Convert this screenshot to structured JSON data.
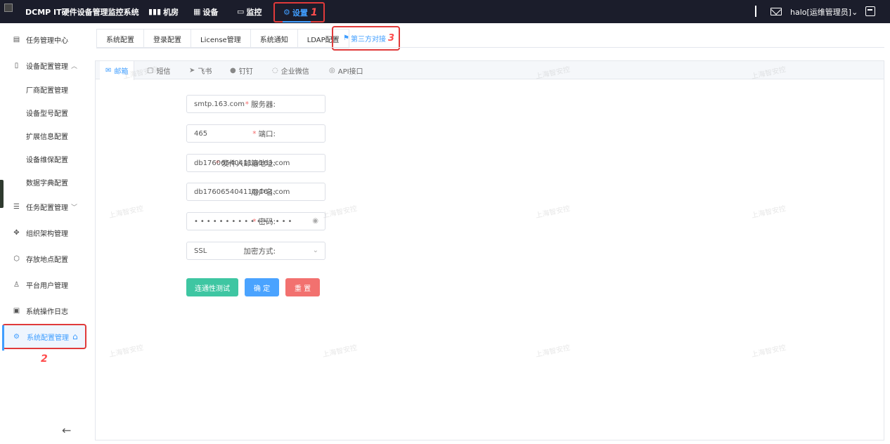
{
  "header": {
    "system_title": "DCMP IT硬件设备管理监控系统",
    "nav": [
      {
        "label": "机房",
        "icon": "bar-chart-icon"
      },
      {
        "label": "设备",
        "icon": "grid-icon"
      },
      {
        "label": "监控",
        "icon": "monitor-icon"
      },
      {
        "label": "设置",
        "icon": "gear-icon",
        "active": true,
        "annotation": "1"
      }
    ],
    "user": "halo[运维管理员]"
  },
  "sidebar": {
    "items": [
      {
        "label": "任务管理中心",
        "icon": "list-icon"
      },
      {
        "label": "设备配置管理",
        "icon": "device-icon",
        "chevron": "^"
      },
      {
        "label": "厂商配置管理",
        "sub": true
      },
      {
        "label": "设备型号配置",
        "sub": true
      },
      {
        "label": "扩展信息配置",
        "sub": true
      },
      {
        "label": "设备维保配置",
        "sub": true
      },
      {
        "label": "数据字典配置",
        "sub": true
      },
      {
        "label": "任务配置管理",
        "icon": "sliders-icon",
        "chevron": "v"
      },
      {
        "label": "组织架构管理",
        "icon": "org-icon"
      },
      {
        "label": "存放地点配置",
        "icon": "cube-icon"
      },
      {
        "label": "平台用户管理",
        "icon": "user-icon"
      },
      {
        "label": "系统操作日志",
        "icon": "log-icon"
      },
      {
        "label": "系统配置管理",
        "icon": "settings-icon",
        "active": true
      }
    ],
    "annotation": "2"
  },
  "tabs": {
    "items": [
      "系统配置",
      "登录配置",
      "License管理",
      "系统通知",
      "LDAP配置"
    ],
    "active": "第三方对接",
    "annotation": "3"
  },
  "subtabs": [
    {
      "label": "邮箱",
      "icon": "mail-icon",
      "active": true
    },
    {
      "label": "短信",
      "icon": "sms-icon"
    },
    {
      "label": "飞书",
      "icon": "send-icon"
    },
    {
      "label": "钉钉",
      "icon": "dingtalk-icon"
    },
    {
      "label": "企业微信",
      "icon": "wechat-icon"
    },
    {
      "label": "API接口",
      "icon": "api-icon"
    }
  ],
  "form": {
    "server": {
      "label": "服务器:",
      "value": "smtp.163.com",
      "required": true
    },
    "port": {
      "label": "端口:",
      "value": "465",
      "required": true
    },
    "sender": {
      "label": "发件人邮箱地址:",
      "value": "db17606540411@163.com",
      "required": true
    },
    "username": {
      "label": "用户名:",
      "value": "db17606540411@163.com",
      "required": false
    },
    "password": {
      "label": "密码:",
      "value": "••••••••••••••••",
      "required": true
    },
    "encryption": {
      "label": "加密方式:",
      "value": "SSL",
      "required": false
    }
  },
  "buttons": {
    "test": "连通性测试",
    "ok": "确 定",
    "reset": "重 置"
  },
  "watermark": "上海智安控",
  "colors": {
    "accent": "#409eff",
    "highlight": "#e03a3a",
    "test_button": "#3ec6a2",
    "ok_button": "#4aa3ff",
    "reset_button": "#f2716f"
  }
}
